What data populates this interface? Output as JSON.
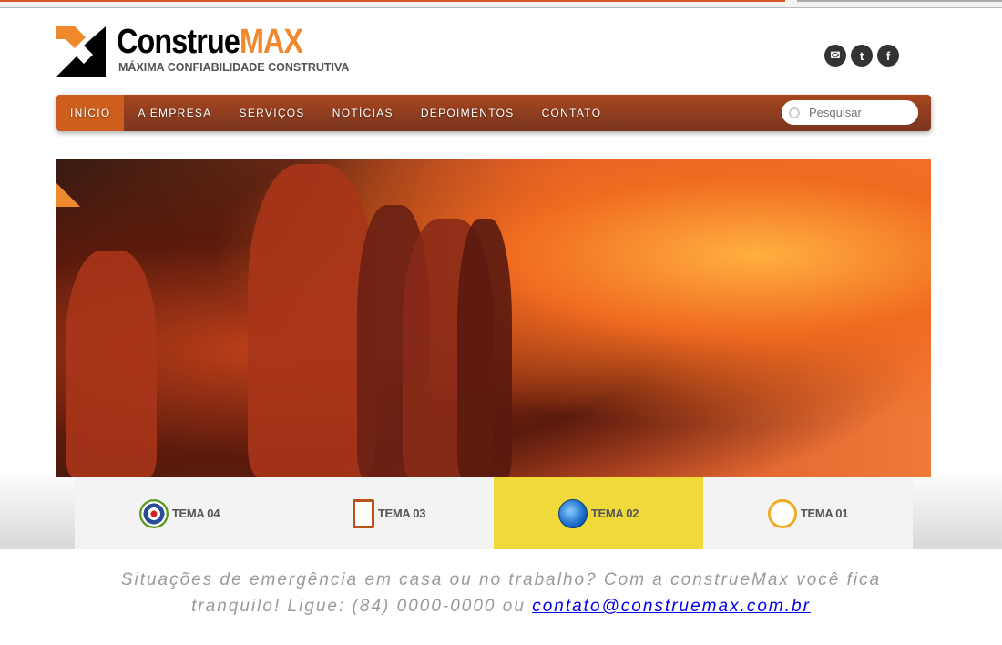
{
  "brand": {
    "name_a": "Construe",
    "name_b": "MAX",
    "tagline": "MÁXIMA CONFIABILIDADE CONSTRUTIVA",
    "accent": "#f0882e"
  },
  "social": [
    {
      "icon": "email-icon",
      "glyph": "✉"
    },
    {
      "icon": "twitter-icon",
      "glyph": "t"
    },
    {
      "icon": "facebook-icon",
      "glyph": "f"
    }
  ],
  "nav": {
    "items": [
      "INÍCIO",
      "A EMPRESA",
      "SERVIÇOS",
      "NOTÍCIAS",
      "DEPOIMENTOS",
      "CONTATO"
    ],
    "active": "INÍCIO",
    "search_placeholder": "Pesquisar"
  },
  "tabs": [
    {
      "label": "TEMA 04",
      "icon": "target-icon"
    },
    {
      "label": "TEMA 03",
      "icon": "clipboard-icon"
    },
    {
      "label": "TEMA 02",
      "icon": "globe-icon",
      "active": true
    },
    {
      "label": "TEMA 01",
      "icon": "clock-icon"
    }
  ],
  "footer": {
    "line1": "Situações de emergência em casa ou no trabalho? Com a construeMax você fica",
    "line2": "tranquilo! Ligue: (84) 0000-0000 ou",
    "email": "contato@construemax.com.br"
  }
}
